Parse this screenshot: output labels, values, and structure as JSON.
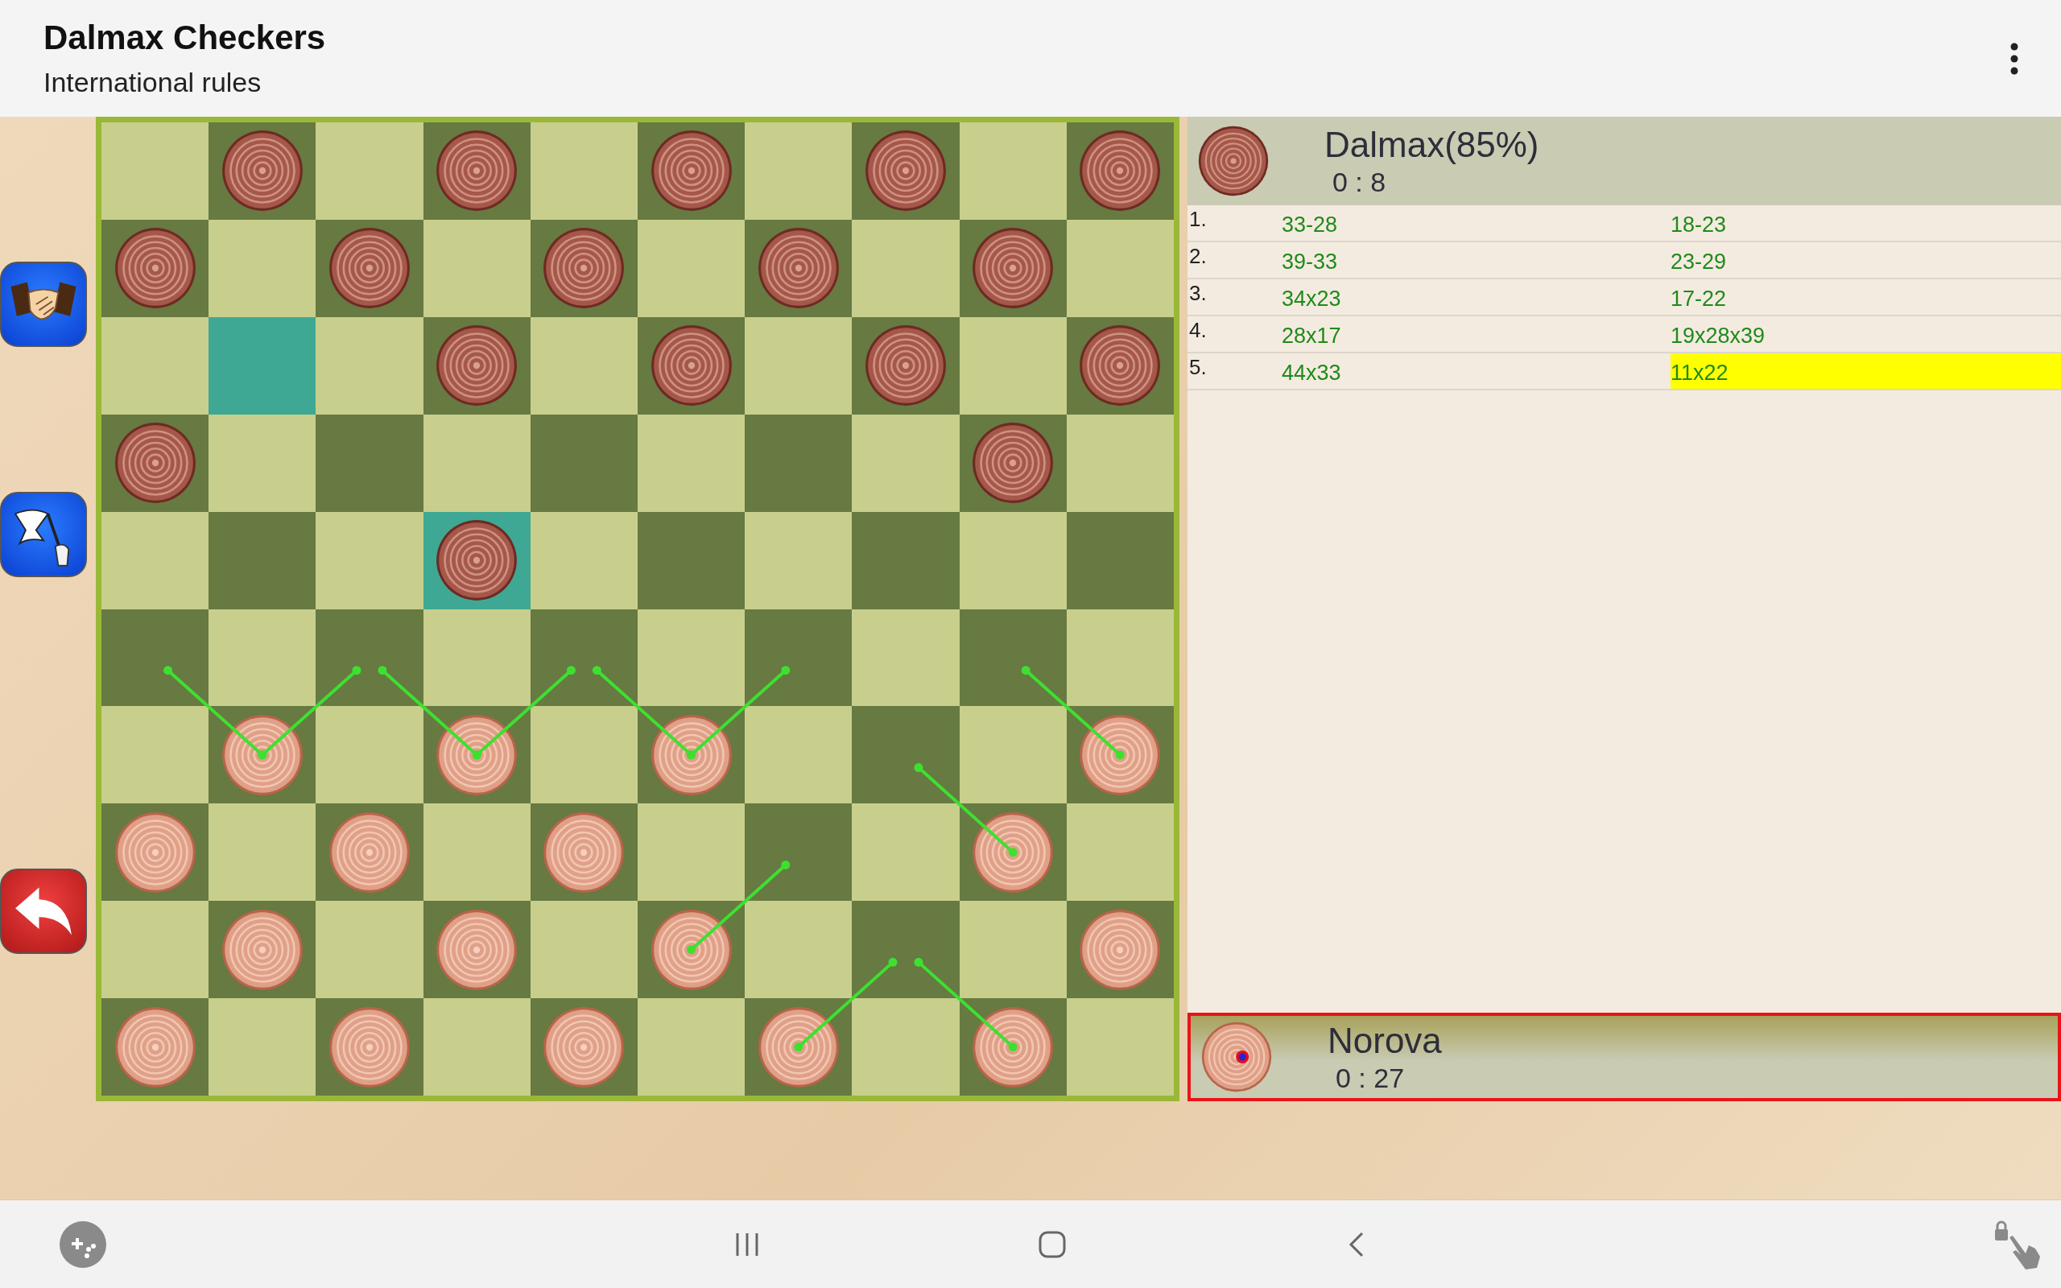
{
  "app_bar": {
    "title": "Dalmax Checkers",
    "subtitle": "International rules"
  },
  "side_buttons": [
    {
      "kind": "draw"
    },
    {
      "kind": "resign"
    },
    {
      "kind": "undo"
    }
  ],
  "board": {
    "rows": [
      {
        "squares": [
          {
            "kind": "dark",
            "highlighted": false,
            "hint_left": false,
            "hint_right": false
          },
          {
            "kind": "dark",
            "highlighted": false,
            "hint_left": false,
            "hint_right": false
          },
          {
            "kind": "dark",
            "highlighted": false,
            "hint_left": false,
            "hint_right": false
          },
          {
            "kind": "dark",
            "highlighted": false,
            "hint_left": false,
            "hint_right": false
          },
          {
            "kind": "dark",
            "highlighted": false,
            "hint_left": false,
            "hint_right": false
          }
        ]
      },
      {
        "squares": [
          {
            "kind": "dark",
            "highlighted": false,
            "hint_left": false,
            "hint_right": false
          },
          {
            "kind": "dark",
            "highlighted": false,
            "hint_left": false,
            "hint_right": false
          },
          {
            "kind": "dark",
            "highlighted": false,
            "hint_left": false,
            "hint_right": false
          },
          {
            "kind": "dark",
            "highlighted": false,
            "hint_left": false,
            "hint_right": false
          },
          {
            "kind": "dark",
            "highlighted": false,
            "hint_left": false,
            "hint_right": false
          }
        ]
      },
      {
        "squares": [
          {
            "kind": "none",
            "highlighted": true,
            "hint_left": false,
            "hint_right": false
          },
          {
            "kind": "dark",
            "highlighted": false,
            "hint_left": false,
            "hint_right": false
          },
          {
            "kind": "dark",
            "highlighted": false,
            "hint_left": false,
            "hint_right": false
          },
          {
            "kind": "dark",
            "highlighted": false,
            "hint_left": false,
            "hint_right": false
          },
          {
            "kind": "dark",
            "highlighted": false,
            "hint_left": false,
            "hint_right": false
          }
        ]
      },
      {
        "squares": [
          {
            "kind": "dark",
            "highlighted": false,
            "hint_left": false,
            "hint_right": false
          },
          {
            "kind": "none",
            "highlighted": false,
            "hint_left": false,
            "hint_right": false
          },
          {
            "kind": "none",
            "highlighted": false,
            "hint_left": false,
            "hint_right": false
          },
          {
            "kind": "none",
            "highlighted": false,
            "hint_left": false,
            "hint_right": false
          },
          {
            "kind": "dark",
            "highlighted": false,
            "hint_left": false,
            "hint_right": false
          }
        ]
      },
      {
        "squares": [
          {
            "kind": "none",
            "highlighted": false,
            "hint_left": false,
            "hint_right": false
          },
          {
            "kind": "dark",
            "highlighted": true,
            "hint_left": false,
            "hint_right": false
          },
          {
            "kind": "none",
            "highlighted": false,
            "hint_left": false,
            "hint_right": false
          },
          {
            "kind": "none",
            "highlighted": false,
            "hint_left": false,
            "hint_right": false
          },
          {
            "kind": "none",
            "highlighted": false,
            "hint_left": false,
            "hint_right": false
          }
        ]
      },
      {
        "squares": [
          {
            "kind": "none",
            "highlighted": false,
            "hint_left": false,
            "hint_right": false
          },
          {
            "kind": "none",
            "highlighted": false,
            "hint_left": false,
            "hint_right": false
          },
          {
            "kind": "none",
            "highlighted": false,
            "hint_left": false,
            "hint_right": false
          },
          {
            "kind": "none",
            "highlighted": false,
            "hint_left": false,
            "hint_right": false
          },
          {
            "kind": "none",
            "highlighted": false,
            "hint_left": false,
            "hint_right": false
          }
        ]
      },
      {
        "squares": [
          {
            "kind": "light",
            "highlighted": false,
            "hint_left": true,
            "hint_right": true
          },
          {
            "kind": "light",
            "highlighted": false,
            "hint_left": true,
            "hint_right": true
          },
          {
            "kind": "light",
            "highlighted": false,
            "hint_left": true,
            "hint_right": true
          },
          {
            "kind": "none",
            "highlighted": false,
            "hint_left": false,
            "hint_right": false
          },
          {
            "kind": "light",
            "highlighted": false,
            "hint_left": true,
            "hint_right": false
          }
        ]
      },
      {
        "squares": [
          {
            "kind": "light",
            "highlighted": false,
            "hint_left": false,
            "hint_right": false
          },
          {
            "kind": "light",
            "highlighted": false,
            "hint_left": false,
            "hint_right": false
          },
          {
            "kind": "light",
            "highlighted": false,
            "hint_left": false,
            "hint_right": false
          },
          {
            "kind": "none",
            "highlighted": false,
            "hint_left": false,
            "hint_right": false
          },
          {
            "kind": "light",
            "highlighted": false,
            "hint_left": true,
            "hint_right": false
          }
        ]
      },
      {
        "squares": [
          {
            "kind": "light",
            "highlighted": false,
            "hint_left": false,
            "hint_right": false
          },
          {
            "kind": "light",
            "highlighted": false,
            "hint_left": false,
            "hint_right": false
          },
          {
            "kind": "light",
            "highlighted": false,
            "hint_left": false,
            "hint_right": true
          },
          {
            "kind": "none",
            "highlighted": false,
            "hint_left": false,
            "hint_right": false
          },
          {
            "kind": "light",
            "highlighted": false,
            "hint_left": false,
            "hint_right": false
          }
        ]
      },
      {
        "squares": [
          {
            "kind": "light",
            "highlighted": false,
            "hint_left": false,
            "hint_right": false
          },
          {
            "kind": "light",
            "highlighted": false,
            "hint_left": false,
            "hint_right": false
          },
          {
            "kind": "light",
            "highlighted": false,
            "hint_left": false,
            "hint_right": false
          },
          {
            "kind": "light",
            "highlighted": false,
            "hint_left": false,
            "hint_right": true
          },
          {
            "kind": "light",
            "highlighted": false,
            "hint_left": true,
            "hint_right": false
          }
        ]
      }
    ]
  },
  "players": [
    {
      "name": "Dalmax(85%)",
      "time": "0 : 8",
      "kind": "dark",
      "to_move": false
    },
    {
      "name": "Norova",
      "time": "0 : 27",
      "kind": "light",
      "to_move": true
    }
  ],
  "moves": [
    {
      "number": "1.",
      "white": "33-28",
      "black": "18-23",
      "white_selected": false,
      "black_selected": false
    },
    {
      "number": "2.",
      "white": "39-33",
      "black": "23-29",
      "white_selected": false,
      "black_selected": false
    },
    {
      "number": "3.",
      "white": "34x23",
      "black": "17-22",
      "white_selected": false,
      "black_selected": false
    },
    {
      "number": "4.",
      "white": "28x17",
      "black": "19x28x39",
      "white_selected": false,
      "black_selected": false
    },
    {
      "number": "5.",
      "white": "44x33",
      "black": "11x22",
      "white_selected": false,
      "black_selected": true
    }
  ],
  "nav_bar": [
    {
      "kind": "game"
    },
    {
      "kind": "recents"
    },
    {
      "kind": "home"
    },
    {
      "kind": "back"
    },
    {
      "kind": "lock"
    }
  ]
}
